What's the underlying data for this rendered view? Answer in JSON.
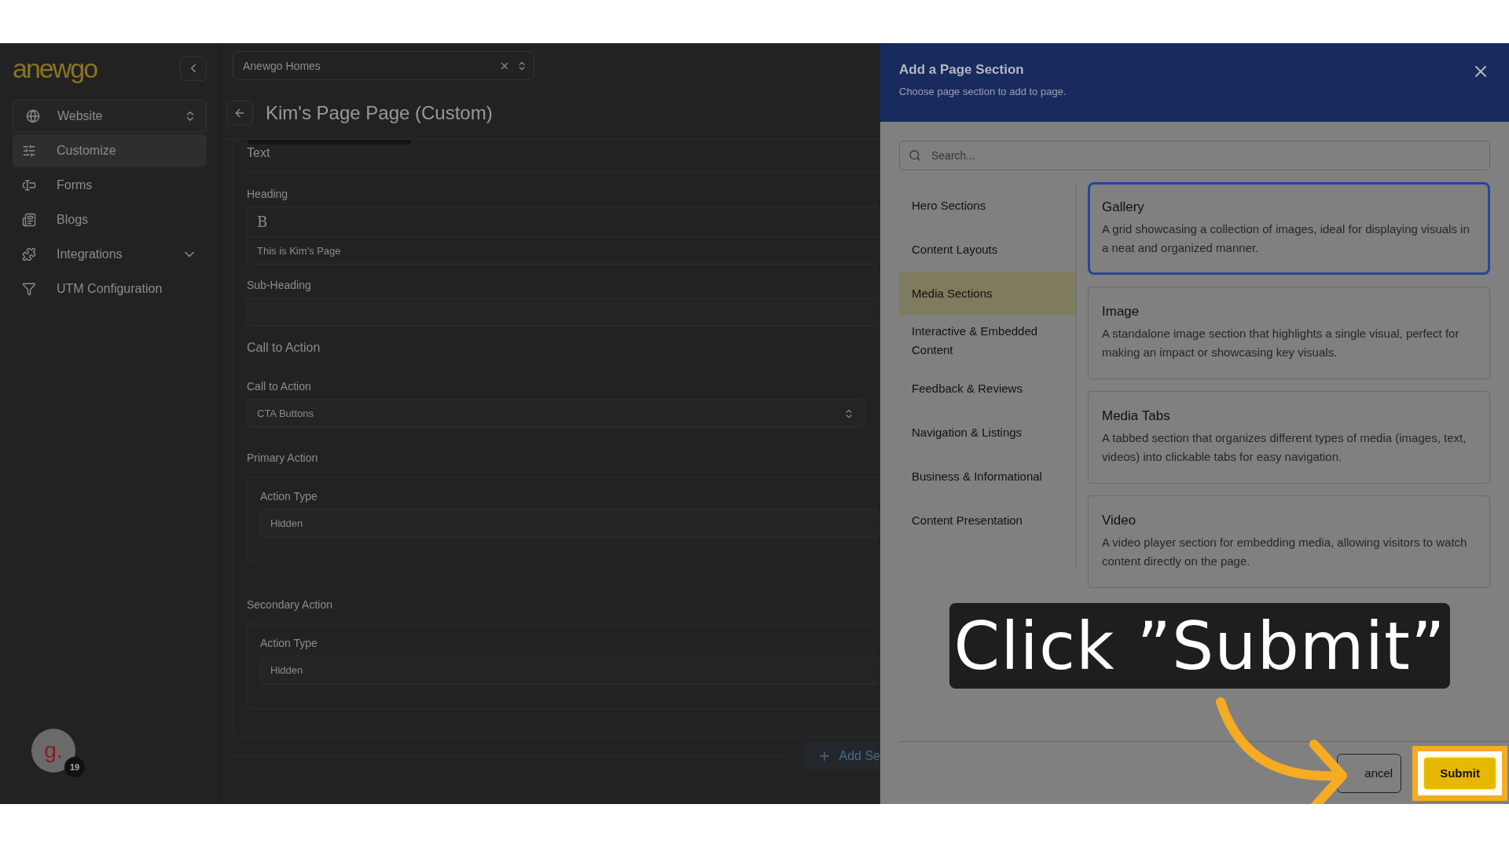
{
  "sidebar": {
    "logo": "anewgo",
    "site_select": {
      "value": "Website"
    },
    "items": [
      {
        "label": "Customize",
        "selected": true,
        "expandable": false
      },
      {
        "label": "Forms",
        "selected": false,
        "expandable": false
      },
      {
        "label": "Blogs",
        "selected": false,
        "expandable": false
      },
      {
        "label": "Integrations",
        "selected": false,
        "expandable": true
      },
      {
        "label": "UTM Configuration",
        "selected": false,
        "expandable": false
      }
    ],
    "avatar": {
      "initial": "g.",
      "badge": "19"
    }
  },
  "main": {
    "community_select": {
      "value": "Anewgo Homes"
    },
    "title": "Kim's Page Page (Custom)",
    "section_label": "Text",
    "heading": {
      "label": "Heading",
      "toolbar_button": "B",
      "value": "This is Kim's Page"
    },
    "sub_heading": {
      "label": "Sub-Heading"
    },
    "cta_title": "Call to Action",
    "cta_select": {
      "label": "Call to Action",
      "value": "CTA Buttons"
    },
    "actions": [
      {
        "title": "Primary Action",
        "label": "Action Type",
        "value": "Hidden"
      },
      {
        "title": "Secondary Action",
        "label": "Action Type",
        "value": "Hidden"
      }
    ],
    "add_button": "Add Se"
  },
  "dialog": {
    "title": "Add a Page Section",
    "subtitle": "Choose page section to add to page.",
    "search": {
      "placeholder": "Search..."
    },
    "categories": [
      {
        "label": "Hero Sections",
        "selected": false
      },
      {
        "label": "Content Layouts",
        "selected": false
      },
      {
        "label": "Media Sections",
        "selected": true
      },
      {
        "label": "Interactive & Embedded Content",
        "selected": false
      },
      {
        "label": "Feedback & Reviews",
        "selected": false
      },
      {
        "label": "Navigation & Listings",
        "selected": false
      },
      {
        "label": "Business & Informational",
        "selected": false
      },
      {
        "label": "Content Presentation",
        "selected": false
      }
    ],
    "sections": [
      {
        "title": "Gallery",
        "description": "A grid showcasing a collection of images, ideal for displaying visuals in a neat and organized manner.",
        "selected": true
      },
      {
        "title": "Image",
        "description": "A standalone image section that highlights a single visual, perfect for making an impact or showcasing key visuals.",
        "selected": false
      },
      {
        "title": "Media Tabs",
        "description": "A tabbed section that organizes different types of media (images, text, videos) into clickable tabs for easy navigation.",
        "selected": false
      },
      {
        "title": "Video",
        "description": "A video player section for embedding media, allowing visitors to watch content directly on the page.",
        "selected": false
      }
    ],
    "buttons": [
      {
        "label": "ancel",
        "kind": "secondary"
      },
      {
        "label": "Submit",
        "kind": "primary"
      }
    ]
  },
  "annotation": {
    "text": "Click ”Submit”"
  }
}
